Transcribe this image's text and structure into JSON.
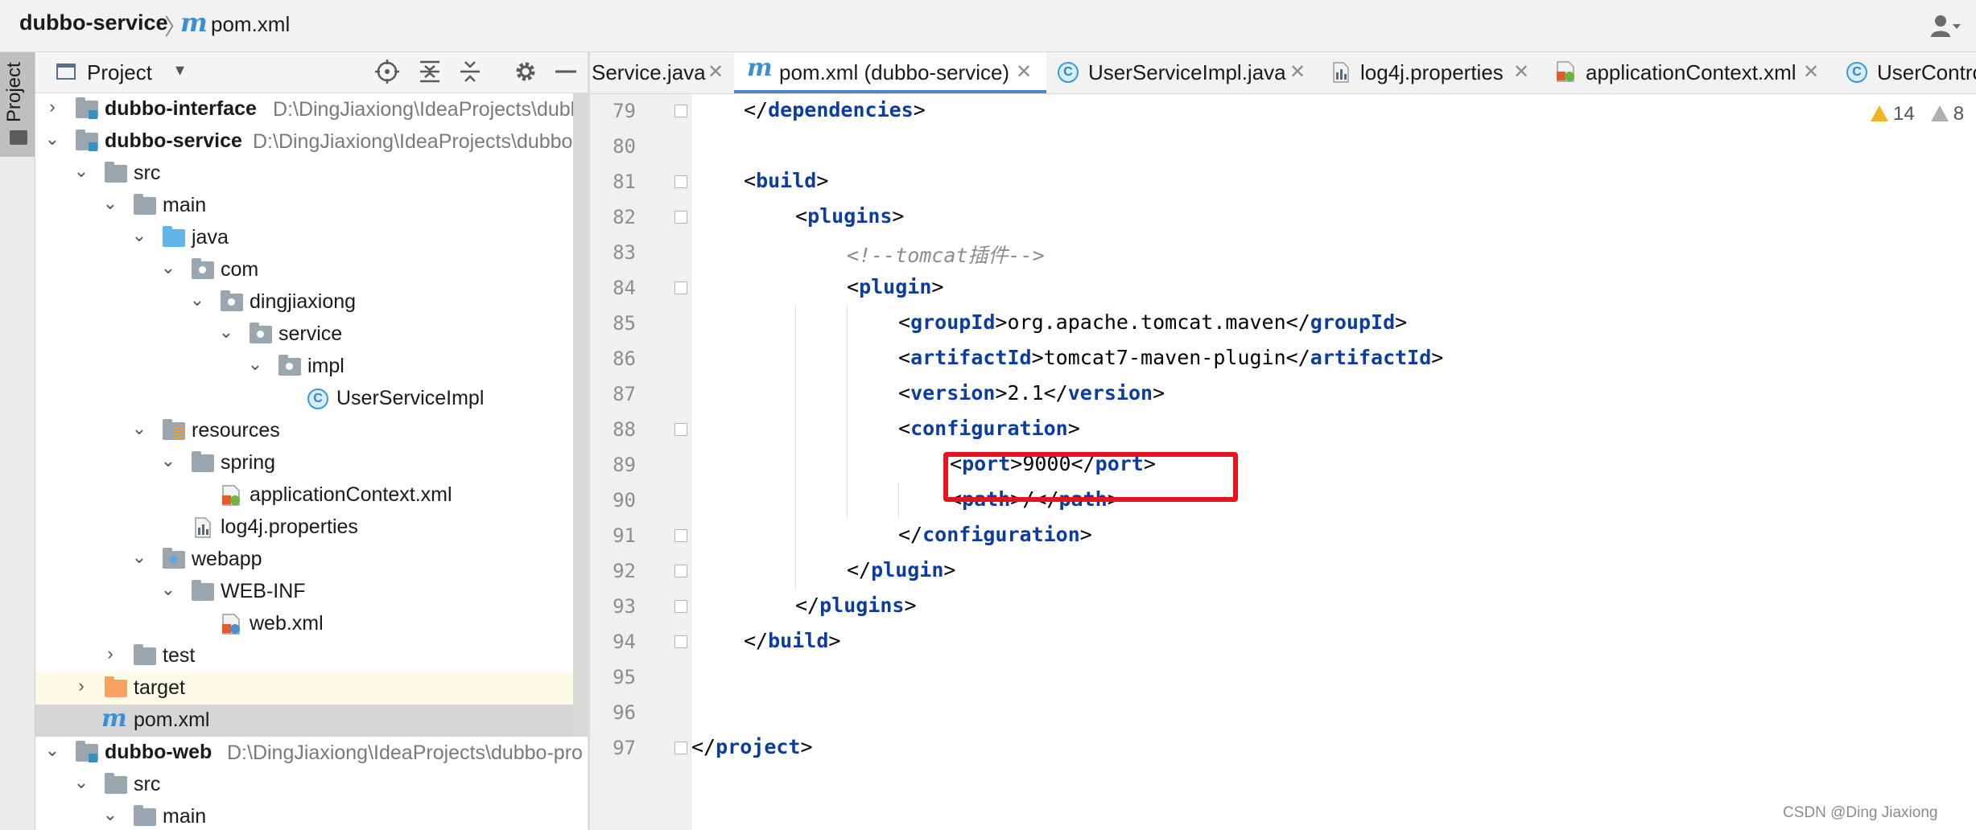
{
  "navbar": {
    "project": "dubbo-service",
    "separator": "〉",
    "file_icon": "m",
    "file": "pom.xml",
    "user_icon": "user-dropdown-icon"
  },
  "sidebar_stripe": {
    "label": "Project"
  },
  "project_panel": {
    "title": "Project",
    "toolbar_icons": [
      "locate-icon",
      "expand-all-icon",
      "collapse-all-icon",
      "gear-icon",
      "hide-icon"
    ],
    "tree": [
      {
        "label": "dubbo-interface",
        "path": "D:\\DingJiaxiong\\IdeaProjects\\dubbo-pro",
        "bold": true
      },
      {
        "label": "dubbo-service",
        "path": "D:\\DingJiaxiong\\IdeaProjects\\dubbo-pro",
        "bold": true
      },
      {
        "label": "src"
      },
      {
        "label": "main"
      },
      {
        "label": "java"
      },
      {
        "label": "com"
      },
      {
        "label": "dingjiaxiong"
      },
      {
        "label": "service"
      },
      {
        "label": "impl"
      },
      {
        "label": "UserServiceImpl"
      },
      {
        "label": "resources"
      },
      {
        "label": "spring"
      },
      {
        "label": "applicationContext.xml"
      },
      {
        "label": "log4j.properties"
      },
      {
        "label": "webapp"
      },
      {
        "label": "WEB-INF"
      },
      {
        "label": "web.xml"
      },
      {
        "label": "test"
      },
      {
        "label": "target"
      },
      {
        "label": "pom.xml"
      },
      {
        "label": "dubbo-web",
        "path": "D:\\DingJiaxiong\\IdeaProjects\\dubbo-pro",
        "bold": true
      },
      {
        "label": "src"
      },
      {
        "label": "main"
      }
    ]
  },
  "tabs": [
    {
      "label": "Service.java"
    },
    {
      "label": "pom.xml (dubbo-service)",
      "icon": "m"
    },
    {
      "label": "UserServiceImpl.java"
    },
    {
      "label": "log4j.properties"
    },
    {
      "label": "applicationContext.xml"
    },
    {
      "label": "UserContro"
    }
  ],
  "editor": {
    "lines": [
      {
        "n": "79",
        "indent": 1,
        "parts": [
          [
            "p",
            "</"
          ],
          [
            "t",
            "dependencies"
          ],
          [
            "p",
            ">"
          ]
        ]
      },
      {
        "n": "80",
        "indent": 0,
        "parts": []
      },
      {
        "n": "81",
        "indent": 1,
        "parts": [
          [
            "p",
            "<"
          ],
          [
            "t",
            "build"
          ],
          [
            "p",
            ">"
          ]
        ]
      },
      {
        "n": "82",
        "indent": 2,
        "parts": [
          [
            "p",
            "<"
          ],
          [
            "t",
            "plugins"
          ],
          [
            "p",
            ">"
          ]
        ]
      },
      {
        "n": "83",
        "indent": 3,
        "parts": [
          [
            "c",
            "<!--tomcat插件-->"
          ]
        ]
      },
      {
        "n": "84",
        "indent": 3,
        "parts": [
          [
            "p",
            "<"
          ],
          [
            "t",
            "plugin"
          ],
          [
            "p",
            ">"
          ]
        ]
      },
      {
        "n": "85",
        "indent": 4,
        "parts": [
          [
            "p",
            "<"
          ],
          [
            "t",
            "groupId"
          ],
          [
            "p",
            ">org.apache.tomcat.maven</"
          ],
          [
            "t",
            "groupId"
          ],
          [
            "p",
            ">"
          ]
        ]
      },
      {
        "n": "86",
        "indent": 4,
        "parts": [
          [
            "p",
            "<"
          ],
          [
            "t",
            "artifactId"
          ],
          [
            "p",
            ">tomcat7-maven-plugin</"
          ],
          [
            "t",
            "artifactId"
          ],
          [
            "p",
            ">"
          ]
        ]
      },
      {
        "n": "87",
        "indent": 4,
        "parts": [
          [
            "p",
            "<"
          ],
          [
            "t",
            "version"
          ],
          [
            "p",
            ">2.1</"
          ],
          [
            "t",
            "version"
          ],
          [
            "p",
            ">"
          ]
        ]
      },
      {
        "n": "88",
        "indent": 4,
        "parts": [
          [
            "p",
            "<"
          ],
          [
            "t",
            "configuration"
          ],
          [
            "p",
            ">"
          ]
        ]
      },
      {
        "n": "89",
        "indent": 5,
        "parts": [
          [
            "p",
            "<"
          ],
          [
            "t",
            "port"
          ],
          [
            "p",
            ">9000</"
          ],
          [
            "t",
            "port"
          ],
          [
            "p",
            ">"
          ]
        ]
      },
      {
        "n": "90",
        "indent": 5,
        "parts": [
          [
            "p",
            "<"
          ],
          [
            "t",
            "path"
          ],
          [
            "p",
            ">/</"
          ],
          [
            "t",
            "path"
          ],
          [
            "p",
            ">"
          ]
        ]
      },
      {
        "n": "91",
        "indent": 4,
        "parts": [
          [
            "p",
            "</"
          ],
          [
            "t",
            "configuration"
          ],
          [
            "p",
            ">"
          ]
        ]
      },
      {
        "n": "92",
        "indent": 3,
        "parts": [
          [
            "p",
            "</"
          ],
          [
            "t",
            "plugin"
          ],
          [
            "p",
            ">"
          ]
        ]
      },
      {
        "n": "93",
        "indent": 2,
        "parts": [
          [
            "p",
            "</"
          ],
          [
            "t",
            "plugins"
          ],
          [
            "p",
            ">"
          ]
        ]
      },
      {
        "n": "94",
        "indent": 1,
        "parts": [
          [
            "p",
            "</"
          ],
          [
            "t",
            "build"
          ],
          [
            "p",
            ">"
          ]
        ]
      },
      {
        "n": "95",
        "indent": 0,
        "parts": []
      },
      {
        "n": "96",
        "indent": 0,
        "parts": []
      },
      {
        "n": "97",
        "indent": 0,
        "parts": [
          [
            "p",
            "</"
          ],
          [
            "t",
            "project"
          ],
          [
            "p",
            ">"
          ]
        ]
      }
    ],
    "highlighted_line": "89"
  },
  "inspections": {
    "warnings": "14",
    "weak_warnings": "8"
  },
  "watermark": "CSDN @Ding Jiaxiong"
}
